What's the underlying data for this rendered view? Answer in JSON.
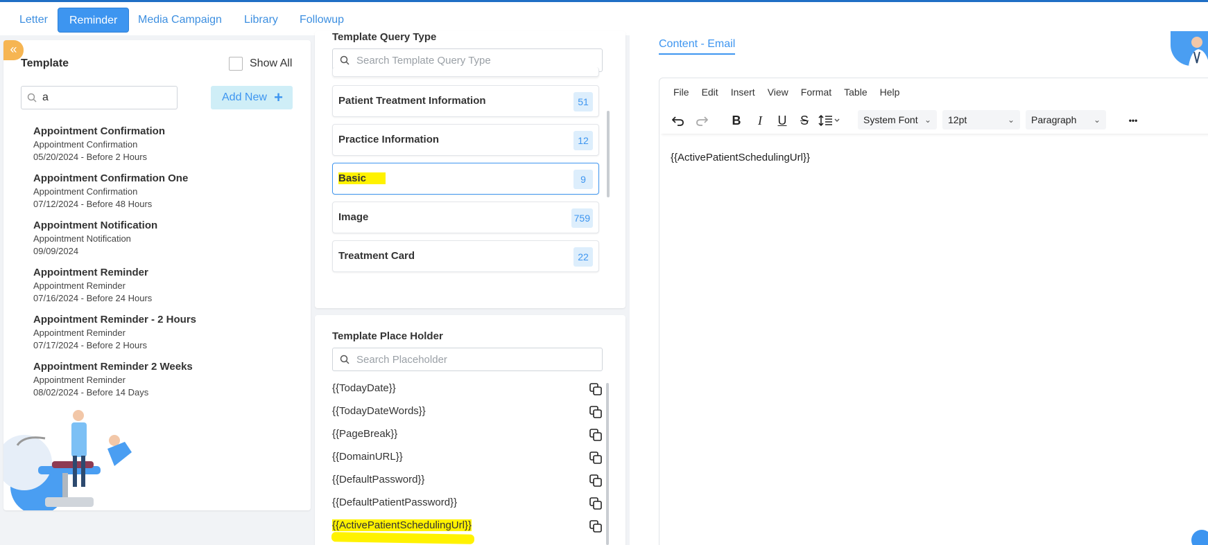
{
  "tabs": [
    {
      "label": "Letter"
    },
    {
      "label": "Reminder"
    },
    {
      "label": "Media Campaign"
    },
    {
      "label": "Library"
    },
    {
      "label": "Followup"
    }
  ],
  "template_panel": {
    "collapse_icon": "«",
    "title": "Template",
    "show_all_label": "Show All",
    "search_value": "a",
    "add_new_label": "Add New",
    "items": [
      {
        "name": "Appointment Confirmation",
        "type": "Appointment Confirmation",
        "date": "05/20/2024 - Before 2 Hours"
      },
      {
        "name": "Appointment Confirmation One",
        "type": "Appointment Confirmation",
        "date": "07/12/2024 - Before 48 Hours"
      },
      {
        "name": "Appointment Notification",
        "type": "Appointment Notification",
        "date": "09/09/2024"
      },
      {
        "name": "Appointment Reminder",
        "type": "Appointment Reminder",
        "date": "07/16/2024 - Before 24 Hours"
      },
      {
        "name": "Appointment Reminder - 2 Hours",
        "type": "Appointment Reminder",
        "date": "07/17/2024 - Before 2 Hours"
      },
      {
        "name": "Appointment Reminder 2 Weeks",
        "type": "Appointment Reminder",
        "date": "08/02/2024 - Before 14 Days"
      }
    ]
  },
  "query_type": {
    "title": "Template Query Type",
    "search_placeholder": "Search Template Query Type",
    "items": [
      {
        "name": "Patient Treatment Information",
        "count": "51"
      },
      {
        "name": "Practice Information",
        "count": "12"
      },
      {
        "name": "Basic",
        "count": "9"
      },
      {
        "name": "Image",
        "count": "759"
      },
      {
        "name": "Treatment Card",
        "count": "22"
      }
    ]
  },
  "placeholder": {
    "title": "Template Place Holder",
    "search_placeholder": "Search Placeholder",
    "items": [
      "{{TodayDate}}",
      "{{TodayDateWords}}",
      "{{PageBreak}}",
      "{{DomainURL}}",
      "{{DefaultPassword}}",
      "{{DefaultPatientPassword}}",
      "{{ActivePatientSchedulingUrl}}"
    ]
  },
  "editor": {
    "content_tab": "Content - Email",
    "menus": [
      "File",
      "Edit",
      "Insert",
      "View",
      "Format",
      "Table",
      "Help"
    ],
    "font_family": "System Font",
    "font_size": "12pt",
    "block_format": "Paragraph",
    "more_icon": "•••",
    "body_text": "{{ActivePatientSchedulingUrl}}"
  },
  "colors": {
    "accent": "#3d95f0",
    "highlight": "#fff200",
    "collapse": "#f6b552"
  }
}
